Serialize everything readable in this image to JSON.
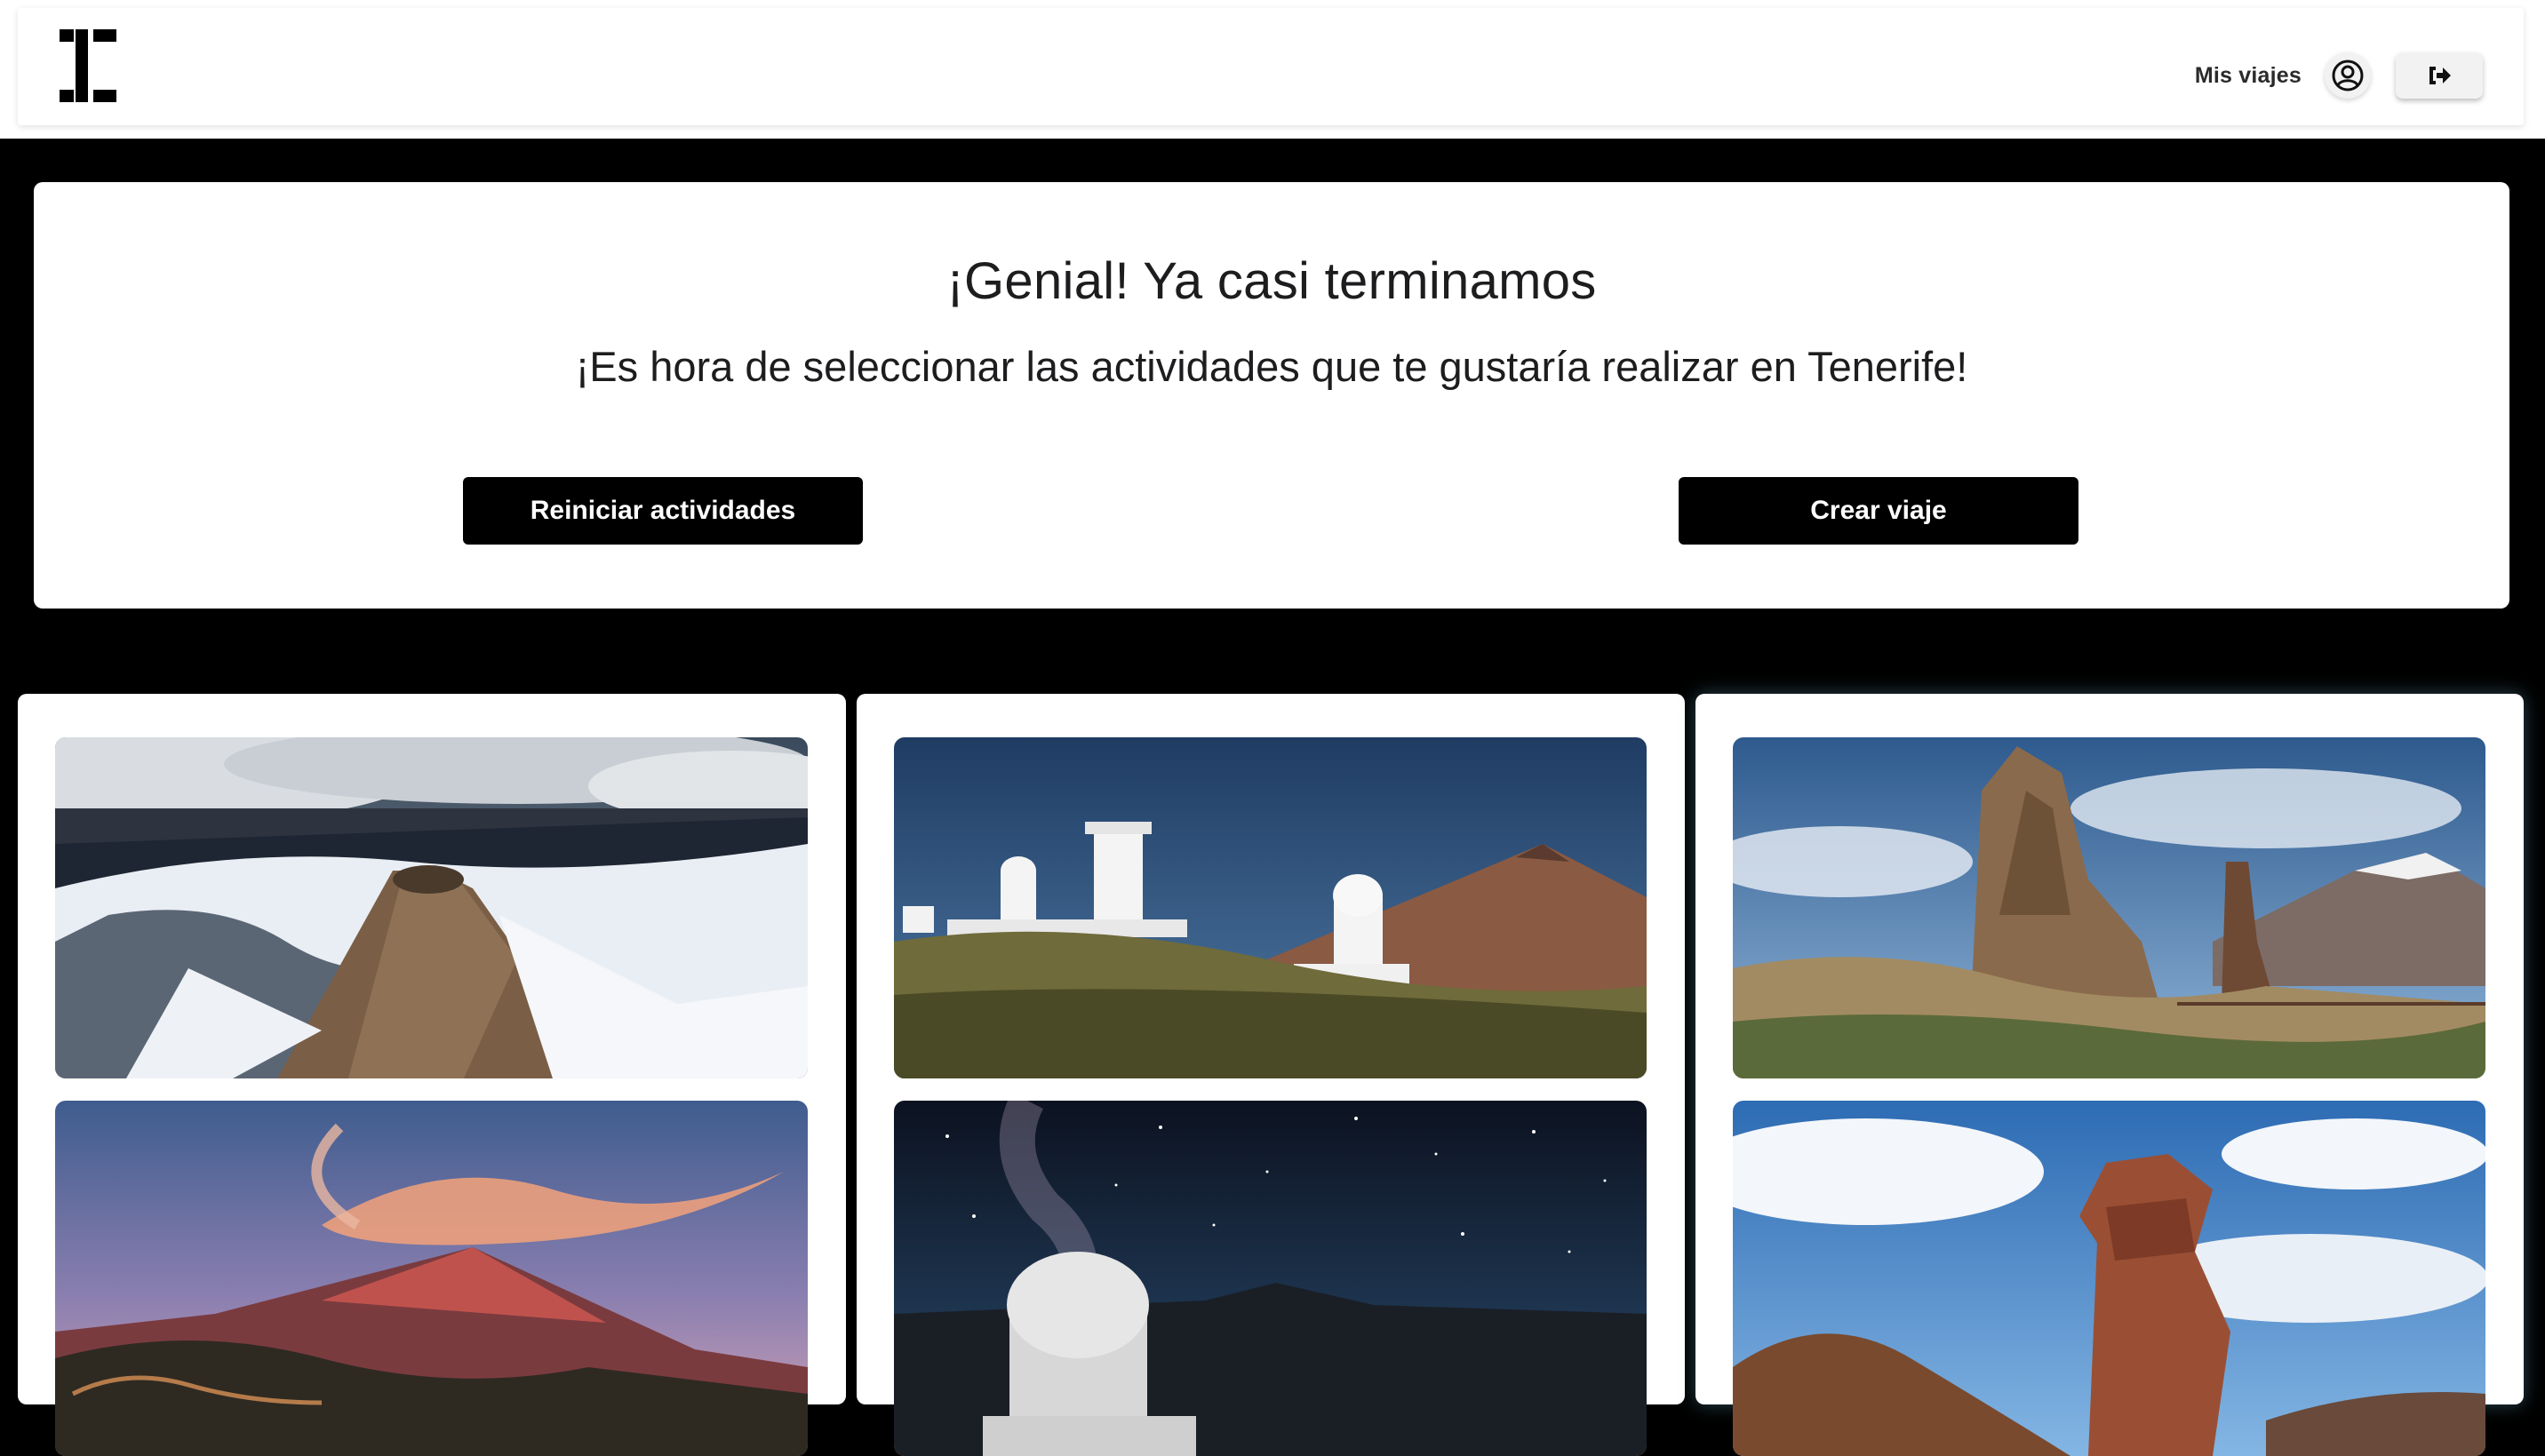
{
  "header": {
    "logo_icon": "app-logo-icon",
    "nav_link_label": "Mis viajes",
    "user_icon": "user-circle-icon",
    "logout_icon": "logout-icon"
  },
  "hero": {
    "title": "¡Genial! Ya casi terminamos",
    "subtitle": "¡Es hora de seleccionar las actividades que te gustaría realizar en Tenerife!",
    "reset_button_label": "Reiniciar actividades",
    "create_button_label": "Crear viaje"
  },
  "activities": {
    "columns": [
      {
        "top_image": "teide-crater-snow-image",
        "bottom_image": "teide-sunset-image"
      },
      {
        "top_image": "teide-observatory-day-image",
        "bottom_image": "observatory-night-sky-image"
      },
      {
        "top_image": "roques-de-garcia-image",
        "bottom_image": "roque-cinchado-image"
      }
    ]
  },
  "colors": {
    "page_background": "#000000",
    "card_background": "#ffffff",
    "button_background": "#000000",
    "button_text": "#ffffff",
    "text_primary": "#1d1d1f"
  }
}
